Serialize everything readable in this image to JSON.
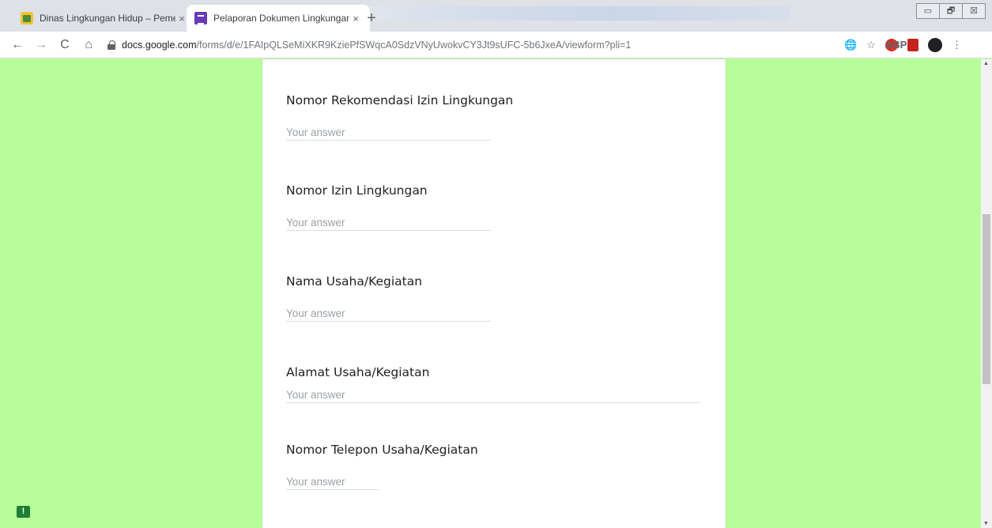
{
  "browser": {
    "tabs": [
      {
        "title": "Dinas Lingkungan Hidup – Peme",
        "close": "×",
        "icon": "home-icon"
      },
      {
        "title": "Pelaporan Dokumen Lingkungan",
        "close": "×",
        "icon": "forms-icon"
      }
    ],
    "new_tab": "+",
    "window_controls": {
      "minimize": "▭",
      "restore": "🗗",
      "close": "☒"
    },
    "nav": {
      "back": "←",
      "forward": "→",
      "reload": "C",
      "home": "⌂"
    },
    "url": {
      "host": "docs.google.com",
      "path": "/forms/d/e/1FAIpQLSeMiXKR9KziePfSWqcA0SdzVNyUwokvCY3Jt9sUFC-5b6JxeA/viewform?pli=1"
    },
    "toolbar_icons": {
      "translate": "🌐",
      "star": "☆",
      "adblock": "ABP",
      "menu": "⋮"
    }
  },
  "form": {
    "accent_background": "#b8fd9b",
    "questions": [
      {
        "title": "Nomor Rekomendasi Izin Lingkungan",
        "placeholder": "Your answer"
      },
      {
        "title": "Nomor Izin Lingkungan",
        "placeholder": "Your answer"
      },
      {
        "title": "Nama Usaha/Kegiatan",
        "placeholder": "Your answer"
      },
      {
        "title": "Alamat Usaha/Kegiatan",
        "placeholder": "Your answer"
      },
      {
        "title": "Nomor Telepon Usaha/Kegiatan",
        "placeholder": "Your answer"
      }
    ]
  },
  "feedback": {
    "label": "!"
  }
}
